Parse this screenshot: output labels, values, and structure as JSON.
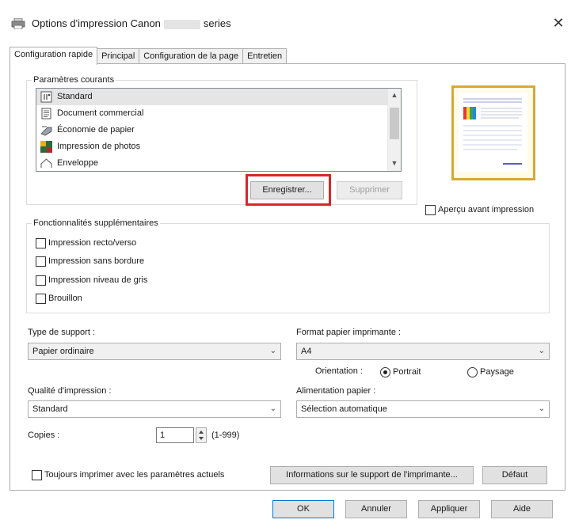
{
  "window": {
    "title_prefix": "Options d'impression Canon",
    "title_suffix": "series",
    "close_glyph": "✕"
  },
  "tabs": [
    {
      "label": "Configuration rapide",
      "active": true
    },
    {
      "label": "Principal",
      "active": false
    },
    {
      "label": "Configuration de la page",
      "active": false
    },
    {
      "label": "Entretien",
      "active": false
    }
  ],
  "current_settings": {
    "group_label": "Paramètres courants",
    "items": [
      {
        "label": "Standard",
        "icon": "standard-icon"
      },
      {
        "label": "Document commercial",
        "icon": "document-icon"
      },
      {
        "label": "Économie de papier",
        "icon": "paper-saving-icon"
      },
      {
        "label": "Impression de photos",
        "icon": "photo-icon"
      },
      {
        "label": "Enveloppe",
        "icon": "envelope-icon"
      }
    ],
    "selected_index": 0,
    "save_button": "Enregistrer...",
    "delete_button": "Supprimer"
  },
  "preview": {
    "checkbox_label": "Aperçu avant impression",
    "checked": false
  },
  "additional_features": {
    "group_label": "Fonctionnalités supplémentaires",
    "options": [
      {
        "label": "Impression recto/verso",
        "checked": false
      },
      {
        "label": "Impression sans bordure",
        "checked": false
      },
      {
        "label": "Impression niveau de gris",
        "checked": false
      },
      {
        "label": "Brouillon",
        "checked": false
      }
    ]
  },
  "media_type": {
    "label": "Type de support :",
    "value": "Papier ordinaire"
  },
  "printer_paper_size": {
    "label": "Format papier imprimante :",
    "value": "A4"
  },
  "orientation": {
    "label": "Orientation :",
    "portrait_label": "Portrait",
    "landscape_label": "Paysage",
    "selected": "portrait"
  },
  "print_quality": {
    "label": "Qualité d'impression :",
    "value": "Standard"
  },
  "paper_source": {
    "label": "Alimentation papier :",
    "value": "Sélection automatique"
  },
  "copies": {
    "label": "Copies :",
    "value": "1",
    "range": "(1-999)"
  },
  "bottom": {
    "always_print_label": "Toujours imprimer avec les paramètres actuels",
    "always_print_checked": false,
    "info_button": "Informations sur le support de l'imprimante...",
    "default_button": "Défaut"
  },
  "dialog_buttons": {
    "ok": "OK",
    "cancel": "Annuler",
    "apply": "Appliquer",
    "help": "Aide"
  },
  "colors": {
    "highlight": "#d8262a",
    "preview_border": "#d9a735"
  }
}
